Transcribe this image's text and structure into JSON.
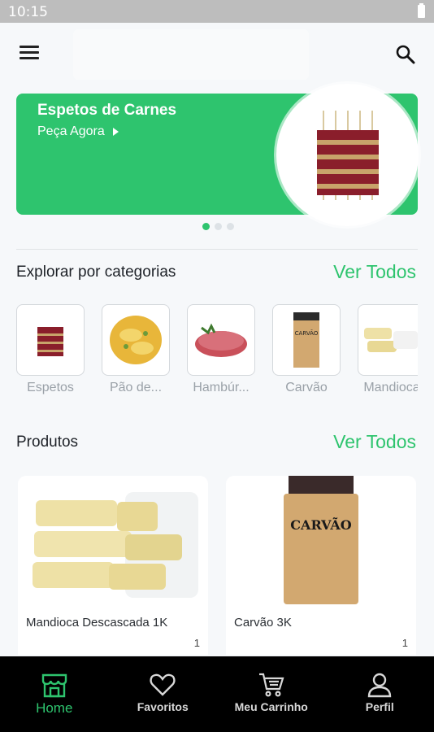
{
  "status_bar": {
    "time": "10:15"
  },
  "banner": {
    "title": "Espetos de Carnes",
    "subtitle": "Peça Agora",
    "color": "#2ec46e"
  },
  "categories_section": {
    "title": "Explorar por categorias",
    "link": "Ver Todos",
    "items": [
      {
        "label": "Espetos"
      },
      {
        "label": "Pão de..."
      },
      {
        "label": "Hambúr..."
      },
      {
        "label": "Carvão"
      },
      {
        "label": "Mandioca"
      }
    ]
  },
  "products_section": {
    "title": "Produtos",
    "link": "Ver Todos",
    "items": [
      {
        "name": "Mandioca Descascada 1K",
        "extra": "1"
      },
      {
        "name": "Carvão 3K",
        "extra": "1"
      }
    ]
  },
  "bottom_nav": {
    "items": [
      {
        "label": "Home",
        "icon": "store-icon",
        "active": true
      },
      {
        "label": "Favoritos",
        "icon": "heart-icon",
        "active": false
      },
      {
        "label": "Meu Carrinho",
        "icon": "cart-icon",
        "active": false
      },
      {
        "label": "Perfil",
        "icon": "user-icon",
        "active": false
      }
    ]
  },
  "colors": {
    "accent": "#2ec46e",
    "nav_background": "#000000"
  }
}
